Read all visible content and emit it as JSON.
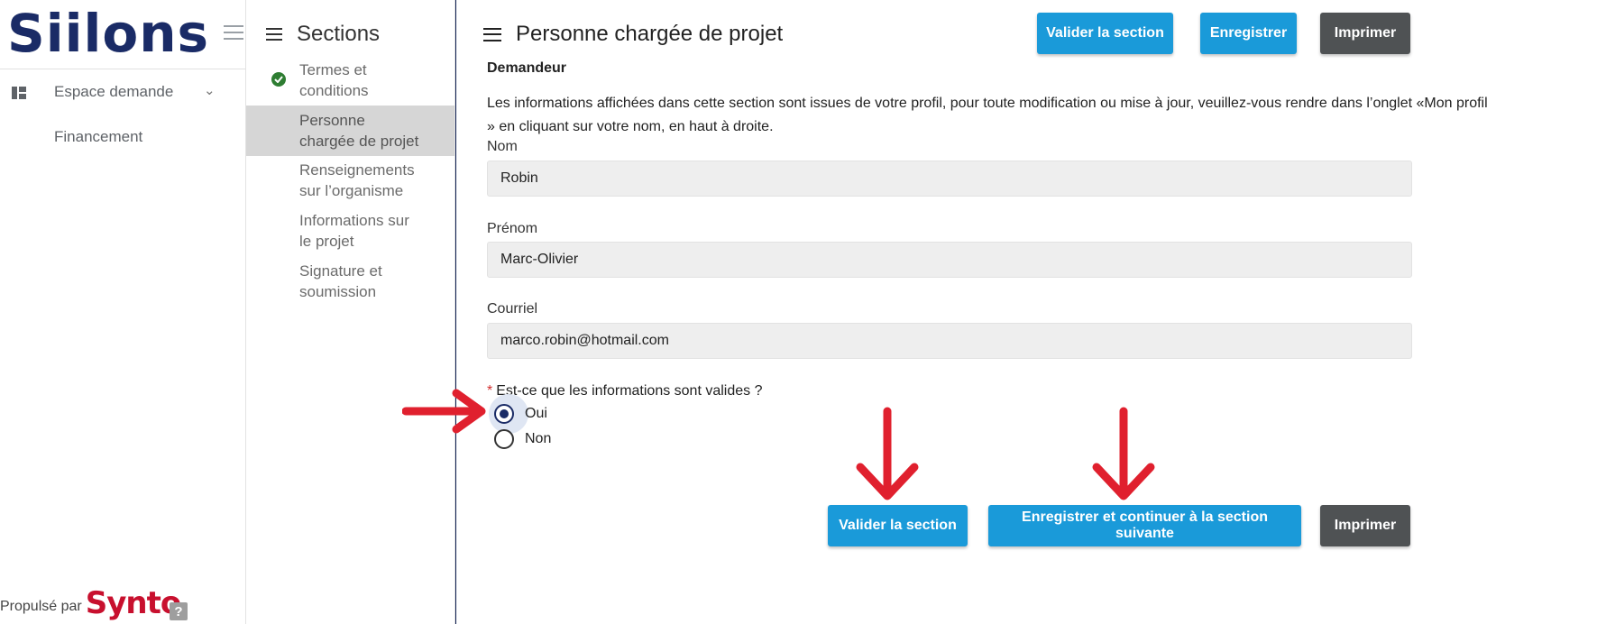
{
  "brand": {
    "logo_text": "Siilons"
  },
  "leftnav": {
    "espace_label": "Espace demande",
    "financement_label": "Financement",
    "powered_by": "Propulsé par",
    "powered_logo": "Synto",
    "help_glyph": "?"
  },
  "sections": {
    "title": "Sections",
    "items": [
      {
        "label": "Termes et conditions",
        "line1": "Termes et",
        "line2": "conditions",
        "status": "completed"
      },
      {
        "label": "Personne chargée de projet",
        "line1": "Personne",
        "line2": "chargée de projet",
        "status": "active"
      },
      {
        "label": "Renseignements sur l’organisme",
        "line1": "Renseignements",
        "line2": "sur l’organisme",
        "status": ""
      },
      {
        "label": "Informations sur le projet",
        "line1": "Informations sur",
        "line2": "le projet",
        "status": ""
      },
      {
        "label": "Signature et soumission",
        "line1": "Signature et",
        "line2": "soumission",
        "status": ""
      }
    ]
  },
  "main": {
    "title": "Personne chargée de projet",
    "top_buttons": {
      "validate": "Valider la section",
      "save": "Enregistrer",
      "print": "Imprimer"
    },
    "section_label": "Demandeur",
    "info_text": "Les informations affichées dans cette section sont issues de votre profil, pour toute modification ou mise à jour, veuillez-vous rendre dans l’onglet «Mon profil » en cliquant sur votre nom, en haut à droite.",
    "fields": {
      "nom_label": "Nom",
      "nom_value": "Robin",
      "prenom_label": "Prénom",
      "prenom_value": "Marc-Olivier",
      "courriel_label": "Courriel",
      "courriel_value": "marco.robin@hotmail.com"
    },
    "question": {
      "required_mark": "*",
      "text": "Est-ce que les informations sont valides ?",
      "options": [
        "Oui",
        "Non"
      ],
      "selected": "Oui"
    },
    "bottom_buttons": {
      "validate": "Valider la section",
      "save_continue": "Enregistrer et continuer à la section suivante",
      "print": "Imprimer"
    }
  },
  "colors": {
    "frame": "#0c1d4f",
    "brand": "#1a2b66",
    "accent_blue": "#1a9ad9",
    "print_grey": "#4f5254",
    "annotation_red": "#e0202e",
    "check_green": "#2e7d32"
  },
  "icons": [
    "hamburger-icon",
    "dashboard-icon",
    "chevron-down-icon",
    "help-icon",
    "list-icon",
    "check-circle-icon",
    "menu-icon",
    "arrow-right-icon",
    "arrow-down-icon"
  ]
}
